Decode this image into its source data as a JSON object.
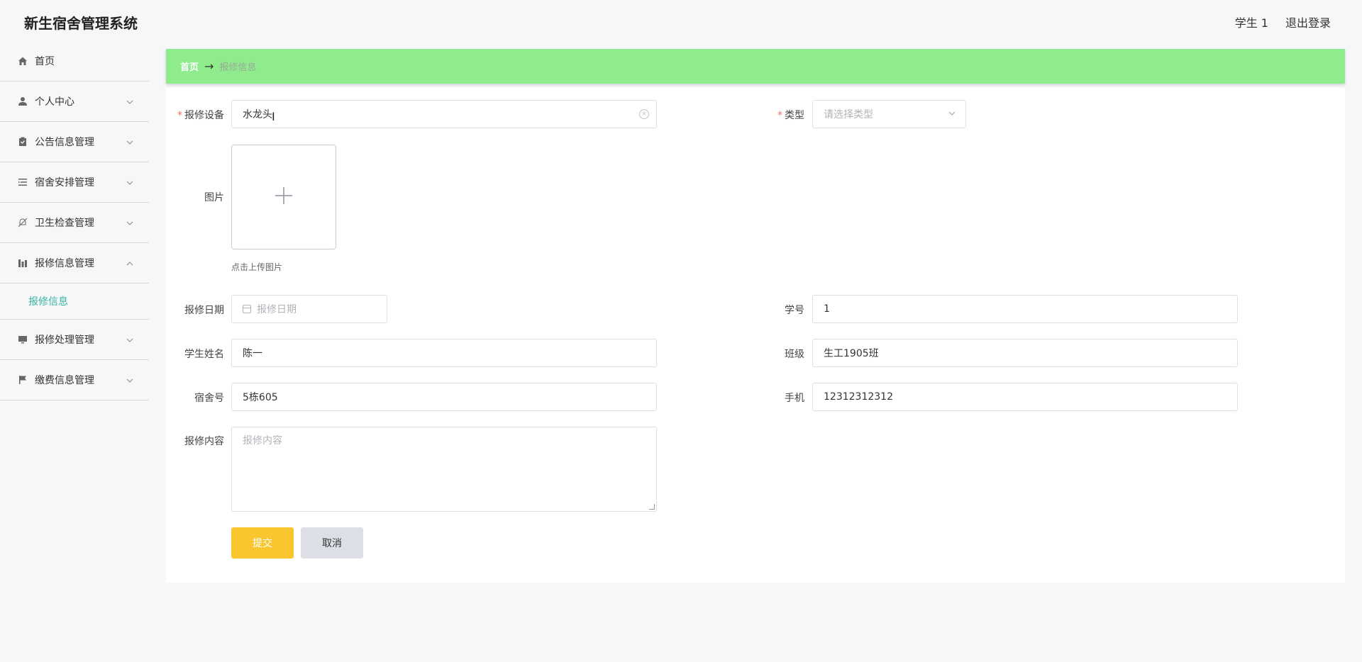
{
  "header": {
    "title": "新生宿舍管理系统",
    "user": "学生 1",
    "logout": "退出登录"
  },
  "sidebar": {
    "items": [
      {
        "label": "首页",
        "icon": "home-icon",
        "expandable": false
      },
      {
        "label": "个人中心",
        "icon": "user-icon",
        "expandable": true
      },
      {
        "label": "公告信息管理",
        "icon": "clipboard-icon",
        "expandable": true
      },
      {
        "label": "宿舍安排管理",
        "icon": "list-icon",
        "expandable": true
      },
      {
        "label": "卫生检查管理",
        "icon": "bell-off-icon",
        "expandable": true
      },
      {
        "label": "报修信息管理",
        "icon": "chart-icon",
        "expandable": true,
        "expanded": true
      },
      {
        "label": "报修处理管理",
        "icon": "monitor-icon",
        "expandable": true
      },
      {
        "label": "缴费信息管理",
        "icon": "flag-icon",
        "expandable": true
      }
    ],
    "sub_item": "报修信息"
  },
  "breadcrumb": {
    "home": "首页",
    "arrow": "→",
    "current": "报修信息"
  },
  "form": {
    "device_label": "报修设备",
    "device_value": "水龙头",
    "type_label": "类型",
    "type_placeholder": "请选择类型",
    "image_label": "图片",
    "upload_tip": "点击上传图片",
    "date_label": "报修日期",
    "date_placeholder": "报修日期",
    "student_no_label": "学号",
    "student_no_value": "1",
    "student_name_label": "学生姓名",
    "student_name_value": "陈一",
    "class_label": "班级",
    "class_value": "生工1905班",
    "dorm_label": "宿舍号",
    "dorm_value": "5栋605",
    "phone_label": "手机",
    "phone_value": "12312312312",
    "content_label": "报修内容",
    "content_placeholder": "报修内容",
    "submit": "提交",
    "cancel": "取消"
  },
  "colors": {
    "breadcrumb_bg": "#8fec8d",
    "submit_bg": "#f9c630",
    "active_sub": "#3ab5a4"
  }
}
